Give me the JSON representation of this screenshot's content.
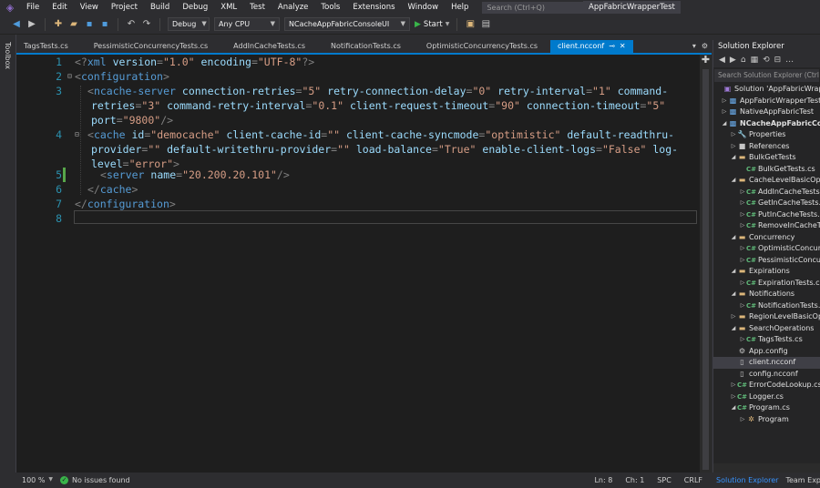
{
  "menubar": {
    "items": [
      "File",
      "Edit",
      "View",
      "Project",
      "Build",
      "Debug",
      "XML",
      "Test",
      "Analyze",
      "Tools",
      "Extensions",
      "Window",
      "Help"
    ],
    "search_placeholder": "Search (Ctrl+Q)",
    "app_title": "AppFabricWrapperTest"
  },
  "toolbar": {
    "config": "Debug",
    "platform": "Any CPU",
    "startup_project": "NCacheAppFabricConsoleUI",
    "start_label": "Start"
  },
  "toolbox": {
    "label": "Toolbox"
  },
  "tabs": [
    {
      "label": "TagsTests.cs",
      "active": false
    },
    {
      "label": "PessimisticConcurrencyTests.cs",
      "active": false
    },
    {
      "label": "AddInCacheTests.cs",
      "active": false
    },
    {
      "label": "NotificationTests.cs",
      "active": false
    },
    {
      "label": "OptimisticConcurrencyTests.cs",
      "active": false
    },
    {
      "label": "client.ncconf",
      "active": true
    }
  ],
  "editor": {
    "line_numbers": [
      "1",
      "2",
      "3",
      "4",
      "5",
      "6",
      "7",
      "8"
    ],
    "code": {
      "l1": {
        "pi_open": "<?",
        "pi_name": "xml",
        "a1": "version",
        "eq": "=",
        "v1": "\"1.0\"",
        "a2": "encoding",
        "v2": "\"UTF-8\"",
        "pi_close": "?>"
      },
      "l2": {
        "lt": "<",
        "tag": "configuration",
        "gt": ">"
      },
      "l3a": {
        "lt": "<",
        "tag": "ncache-server",
        "a1": "connection-retries",
        "v1": "\"5\"",
        "a2": "retry-connection-delay",
        "v2": "\"0\"",
        "a3": "retry-interval",
        "v3": "\"1\"",
        "a4": "command-"
      },
      "l3b": {
        "a4b": "retries",
        "v4": "\"3\"",
        "a5": "command-retry-interval",
        "v5": "\"0.1\"",
        "a6": "client-request-timeout",
        "v6": "\"90\"",
        "a7": "connection-timeout",
        "v7": "\"5\""
      },
      "l3c": {
        "a8": "port",
        "v8": "\"9800\"",
        "close": "/>"
      },
      "l4a": {
        "lt": "<",
        "tag": "cache",
        "a1": "id",
        "v1": "\"democache\"",
        "a2": "client-cache-id",
        "v2": "\"\"",
        "a3": "client-cache-syncmode",
        "v3": "\"optimistic\"",
        "a4": "default-readthru-"
      },
      "l4b": {
        "a4b": "provider",
        "v4": "\"\"",
        "a5": "default-writethru-provider",
        "v5": "\"\"",
        "a6": "load-balance",
        "v6": "\"True\"",
        "a7": "enable-client-logs",
        "v7": "\"False\"",
        "a8": "log-"
      },
      "l4c": {
        "a8b": "level",
        "v8": "\"error\"",
        "gt": ">"
      },
      "l5": {
        "lt": "<",
        "tag": "server",
        "a1": "name",
        "v1": "\"20.200.20.101\"",
        "close": "/>"
      },
      "l6": {
        "lt": "</",
        "tag": "cache",
        "gt": ">"
      },
      "l7": {
        "lt": "</",
        "tag": "configuration",
        "gt": ">"
      }
    }
  },
  "solution_explorer": {
    "title": "Solution Explorer",
    "search_placeholder": "Search Solution Explorer (Ctrl+;)",
    "tree": [
      {
        "label": "Solution 'AppFabricWrapperTest'",
        "icon": "solution-icon"
      },
      {
        "label": "AppFabricWrapperTest",
        "icon": "project-icon"
      },
      {
        "label": "NativeAppFabricTest",
        "icon": "project-icon"
      },
      {
        "label": "NCacheAppFabricConsoleUI",
        "icon": "project-icon"
      },
      {
        "label": "Properties",
        "icon": "wrench-icon"
      },
      {
        "label": "References",
        "icon": "references-icon"
      },
      {
        "label": "BulkGetTests",
        "icon": "folder-icon"
      },
      {
        "label": "BulkGetTests.cs",
        "icon": "csharp-file-icon"
      },
      {
        "label": "CacheLevelBasicOperations",
        "icon": "folder-icon"
      },
      {
        "label": "AddInCacheTests.cs",
        "icon": "csharp-file-icon"
      },
      {
        "label": "GetInCacheTests.cs",
        "icon": "csharp-file-icon"
      },
      {
        "label": "PutInCacheTests.cs",
        "icon": "csharp-file-icon"
      },
      {
        "label": "RemoveInCacheTests.cs",
        "icon": "csharp-file-icon"
      },
      {
        "label": "Concurrency",
        "icon": "folder-icon"
      },
      {
        "label": "OptimisticConcurrencyTests.cs",
        "icon": "csharp-file-icon"
      },
      {
        "label": "PessimisticConcurrencyTests.cs",
        "icon": "csharp-file-icon"
      },
      {
        "label": "Expirations",
        "icon": "folder-icon"
      },
      {
        "label": "ExpirationTests.cs",
        "icon": "csharp-file-icon"
      },
      {
        "label": "Notifications",
        "icon": "folder-icon"
      },
      {
        "label": "NotificationTests.cs",
        "icon": "csharp-file-icon"
      },
      {
        "label": "RegionLevelBasicOperations",
        "icon": "folder-icon"
      },
      {
        "label": "SearchOperations",
        "icon": "folder-icon"
      },
      {
        "label": "TagsTests.cs",
        "icon": "csharp-file-icon"
      },
      {
        "label": "App.config",
        "icon": "config-file-icon"
      },
      {
        "label": "client.ncconf",
        "icon": "file-icon"
      },
      {
        "label": "config.ncconf",
        "icon": "file-icon"
      },
      {
        "label": "ErrorCodeLookup.cs",
        "icon": "csharp-file-icon"
      },
      {
        "label": "Logger.cs",
        "icon": "csharp-file-icon"
      },
      {
        "label": "Program.cs",
        "icon": "csharp-file-icon"
      },
      {
        "label": "Program",
        "icon": "class-icon"
      }
    ],
    "bottom_tabs": [
      "Solution Explorer",
      "Team Explorer"
    ]
  },
  "status": {
    "zoom": "100 %",
    "issues": "No issues found",
    "line": "Ln: 8",
    "col": "Ch: 1",
    "spc": "SPC",
    "eol": "CRLF"
  },
  "colors": {
    "accent": "#007acc",
    "editor_bg": "#1e1e1e",
    "xml_tag": "#569cd6",
    "xml_attr": "#9cdcfe",
    "xml_value": "#d69d85"
  }
}
